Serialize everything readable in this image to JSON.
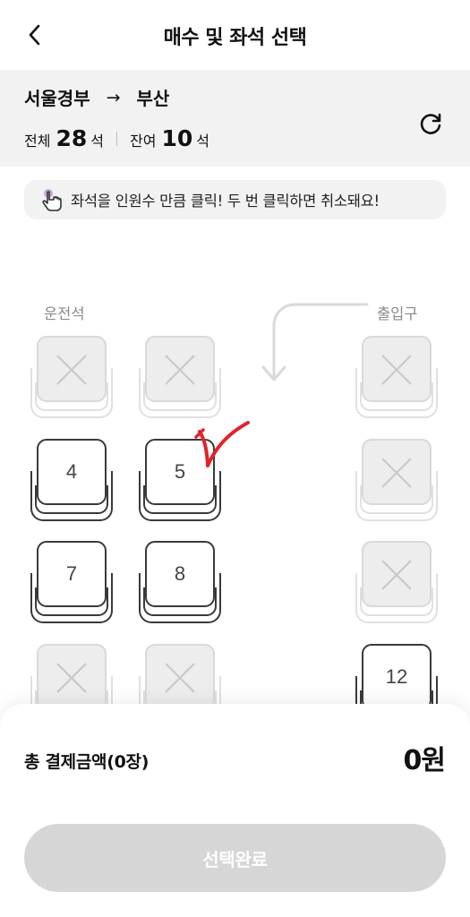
{
  "header": {
    "title": "매수 및 좌석 선택",
    "back_icon": "chevron-left-icon"
  },
  "route": {
    "from": "서울경부",
    "arrow": "→",
    "to": "부산"
  },
  "counts": {
    "total_label": "전체",
    "total_value": "28",
    "total_unit": "석",
    "remaining_label": "잔여",
    "remaining_value": "10",
    "remaining_unit": "석"
  },
  "refresh_icon": "refresh-icon",
  "notice": {
    "text": "좌석을 인원수 만큼 클릭! 두 번 클릭하면 취소돼요!",
    "icon": "hand-pointer-icon"
  },
  "seatmap": {
    "driver_label": "운전석",
    "entrance_label": "출입구",
    "seats": [
      {
        "number": "",
        "status": "taken"
      },
      {
        "number": "",
        "status": "taken"
      },
      {
        "number": "",
        "status": "taken"
      },
      {
        "number": "4",
        "status": "available"
      },
      {
        "number": "5",
        "status": "available"
      },
      {
        "number": "",
        "status": "taken"
      },
      {
        "number": "7",
        "status": "available"
      },
      {
        "number": "8",
        "status": "available"
      },
      {
        "number": "",
        "status": "taken"
      },
      {
        "number": "",
        "status": "taken"
      },
      {
        "number": "",
        "status": "taken"
      },
      {
        "number": "12",
        "status": "available"
      }
    ]
  },
  "summary": {
    "total_label": "총 결제금액(0장)",
    "total_price": "0원"
  },
  "complete_button": {
    "label": "선택완료",
    "enabled": false
  },
  "colors": {
    "accent_check": "#e0242b",
    "disabled_button": "#d6d6d6",
    "panel_bg": "#f2f2f2"
  }
}
